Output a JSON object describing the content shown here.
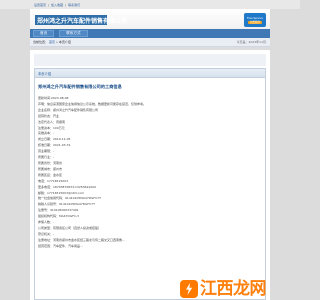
{
  "topbar": {
    "items": [
      "设置首页",
      "|",
      "加入收藏",
      "|",
      "联系我们"
    ]
  },
  "header": {
    "logo_text": "郑州鸿之升汽车配件销售有限公司",
    "badge_line1": "Free Service",
    "badge_line2": "免费服务"
  },
  "nav": {
    "items": [
      "首页",
      "联系方式"
    ]
  },
  "breadcrumb": {
    "prefix": "当前位置：",
    "home": "首页",
    "sep": "»",
    "current": "本页介绍",
    "right": "今天是：2023年11月"
  },
  "panel": {
    "head": "本页介绍",
    "title": "郑州鸿之升汽车配件销售有限公司的工商信息",
    "rows": [
      "更新时间:2023-08-08",
      "声明：信息来源国家企业信用信息公示系统，数据更新可能存在延迟，仅供参考。",
      "企业名称：郑州鸿之升汽车配件销售有限公司",
      "经营状态：开业",
      "法定代表人：周振南",
      "注册资本：100万元",
      "实缴资本：-",
      "成立日期：2019-11-05",
      "核准日期：2021-03-31",
      "营业期限：-",
      "所属行业：-",
      "所属省份：河南省",
      "所属城市：郑州市",
      "所属区县：金水区",
      "电话：17716515003",
      "更多电话：18703870833;13253691000",
      "邮箱：17716515003@163.com",
      "统一社会信用代码：91410105MA47DGFC7T",
      "纳税人识别号：91410105MA47DGFC7T",
      "注册号：410105000337491",
      "组织机构代码：MA47DGFC-3",
      "参保人数：-",
      "公司类型：有限责任公司（自然人投资或控股）",
      "登记机关：-",
      "注册地址：河南省郑州市金水区经三路北与纬二路交叉口西南角…",
      "经营范围：汽车配件、汽车用品…"
    ]
  },
  "watermark": {
    "text": "江西龙网"
  },
  "colors": {
    "accent": "#2f6ea8",
    "nav": "#3f78b4",
    "watermark": "#ff7a00"
  }
}
